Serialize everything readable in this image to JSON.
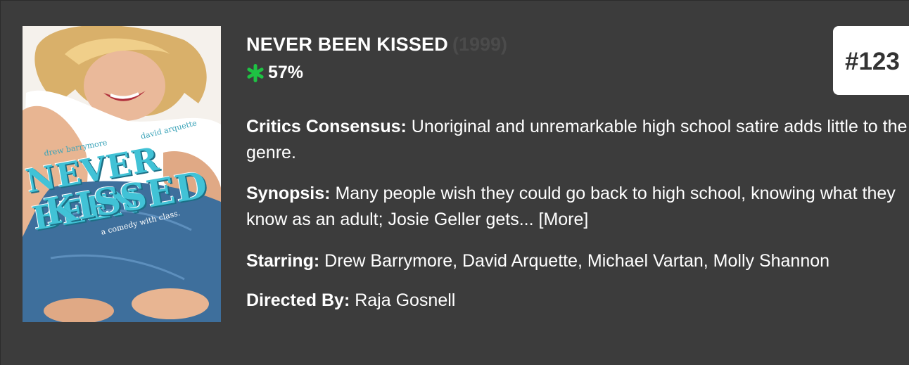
{
  "movie": {
    "title": "NEVER BEEN KISSED",
    "year": "(1999)",
    "score": "57%",
    "rank": "#123",
    "critics_label": "Critics Consensus:",
    "critics_text": "Unoriginal and unremarkable high school satire adds little to the genre.",
    "synopsis_label": "Synopsis:",
    "synopsis_text": "Many people wish they could go back to high school, knowing what they know as an adult; Josie Geller gets...",
    "more_link": "[More]",
    "starring_label": "Starring:",
    "starring_text": "Drew Barrymore, David Arquette, Michael Vartan, Molly Shannon",
    "directed_label": "Directed By:",
    "directed_text": "Raja Gosnell"
  },
  "poster": {
    "actor1": "drew barrymore",
    "actor2": "david arquette",
    "title_line1": "NEVER BEEN",
    "title_line2": "KISSED",
    "tagline": "a comedy with class."
  },
  "colors": {
    "background": "#3c3c3c",
    "splat": "#1ec243",
    "rank_box": "#ffffff"
  }
}
